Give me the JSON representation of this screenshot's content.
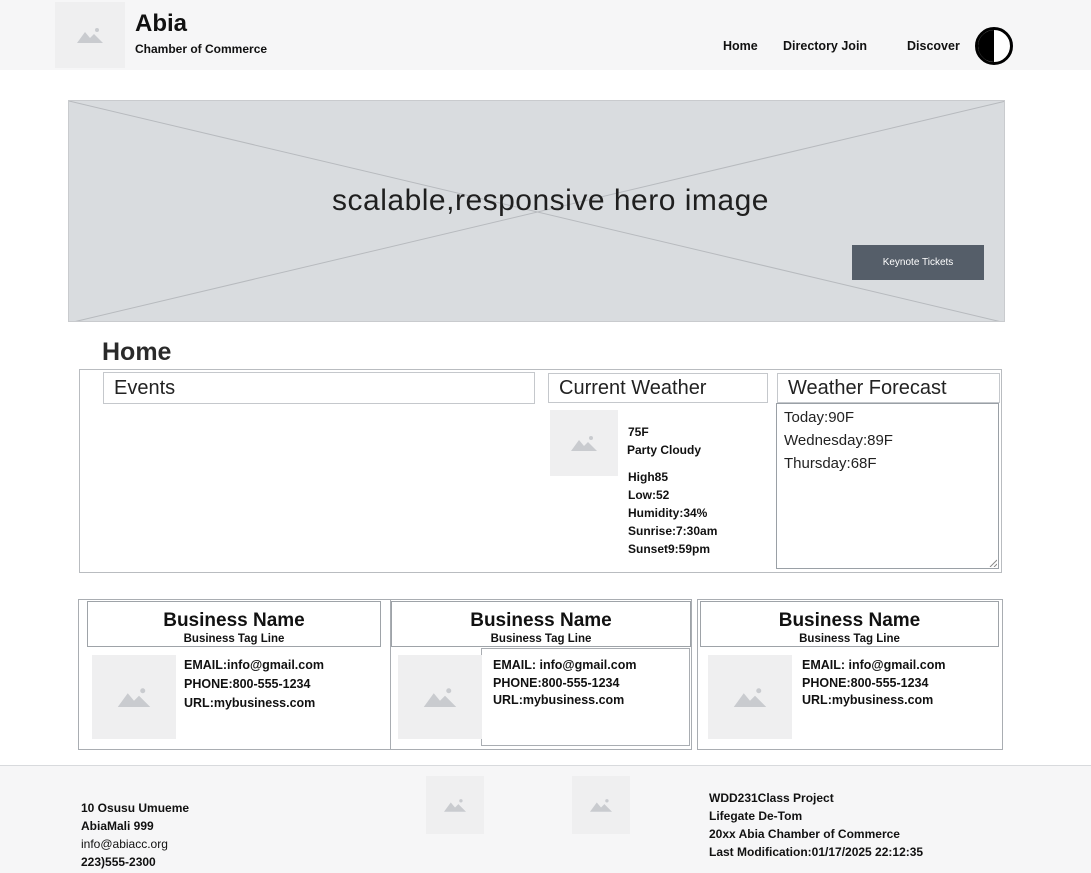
{
  "header": {
    "brand_name": "Abia",
    "brand_subtitle": "Chamber of Commerce",
    "nav": [
      "Home",
      "Directory Join",
      "Discover"
    ],
    "theme_toggle_icon": "contrast-icon"
  },
  "hero": {
    "text": "scalable,responsive hero image",
    "button_label": "Keynote Tickets"
  },
  "page_title": "Home",
  "events": {
    "heading": "Events"
  },
  "current_weather": {
    "heading": "Current Weather",
    "icon": "image-placeholder-icon",
    "temp": "75F",
    "condition": "Party Cloudy",
    "details": [
      "High85",
      "Low:52",
      "Humidity:34%",
      "Sunrise:7:30am",
      "Sunset9:59pm"
    ]
  },
  "forecast": {
    "heading": "Weather Forecast",
    "days": [
      "Today:90F",
      "Wednesday:89F",
      "Thursday:68F"
    ]
  },
  "businesses": [
    {
      "name": "Business Name",
      "tagline": "Business Tag Line",
      "email": "EMAIL:info@gmail.com",
      "phone": "PHONE:800-555-1234",
      "url": "URL:mybusiness.com"
    },
    {
      "name": "Business Name",
      "tagline": "Business Tag Line",
      "email": "EMAIL: info@gmail.com",
      "phone": "PHONE:800-555-1234",
      "url": "URL:mybusiness.com"
    },
    {
      "name": "Business Name",
      "tagline": "Business Tag Line",
      "email": "EMAIL: info@gmail.com",
      "phone": "PHONE:800-555-1234",
      "url": "URL:mybusiness.com"
    }
  ],
  "footer": {
    "contact": [
      "10 Osusu Umueme",
      "AbiaMali 999",
      "info@abiacc.org",
      "223)555-2300"
    ],
    "project": [
      "WDD231Class Project",
      "Lifegate De-Tom",
      "20xx Abia Chamber of Commerce",
      "Last Modification:01/17/2025 22:12:35"
    ]
  }
}
